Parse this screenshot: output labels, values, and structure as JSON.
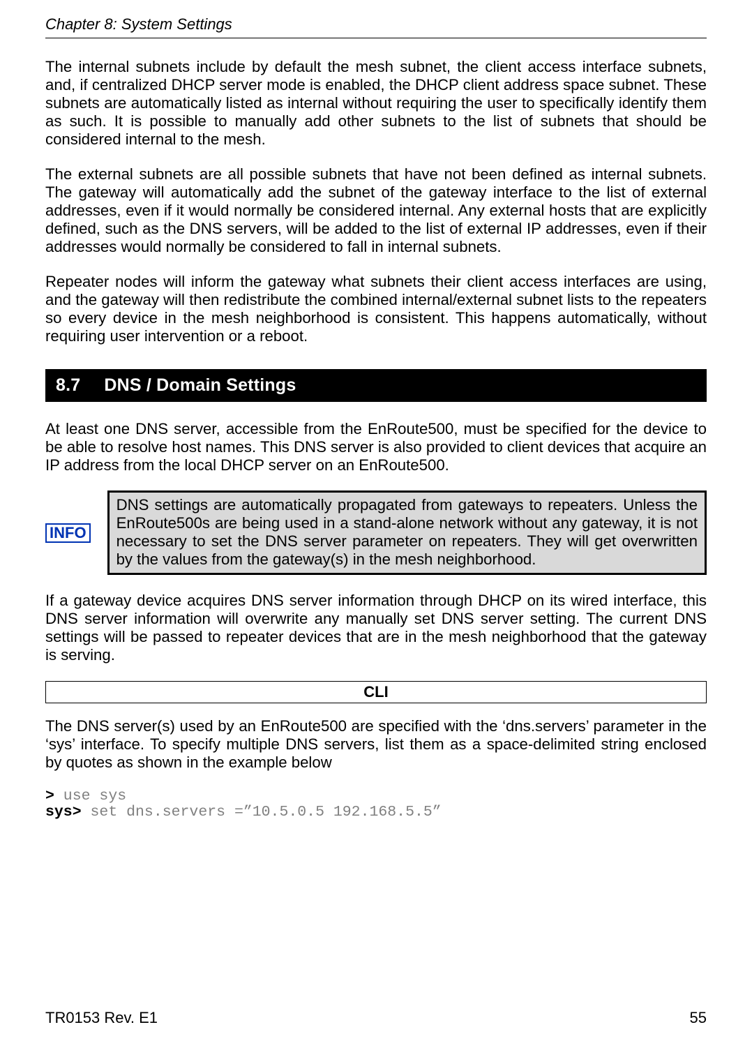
{
  "header": "Chapter 8: System Settings",
  "p1": "The internal subnets include by default the mesh subnet, the client access interface subnets, and, if centralized DHCP server mode is enabled, the DHCP client address space subnet. These subnets are automatically listed as internal without requiring the user to specifically identify them as such. It is possible to manually add other subnets to the list of subnets that should be considered internal to the mesh.",
  "p2": "The external subnets are all possible subnets that have not been defined as internal subnets. The gateway will automatically add the subnet of the gateway interface to the list of external addresses, even if it would normally be considered internal. Any external hosts that are explicitly defined, such as the DNS servers, will be added to the list of external IP addresses, even if their addresses would normally be considered to fall in internal subnets.",
  "p3": "Repeater nodes will inform the gateway what subnets their client access interfaces are using, and the gateway will then redistribute the combined internal/external subnet lists to the repeaters so every device in the mesh neighborhood is consistent. This happens automatically, without requiring user intervention or a reboot.",
  "section": {
    "num": "8.7",
    "title": "DNS / Domain Settings"
  },
  "p4": "At least one DNS server, accessible from the EnRoute500, must be specified for the device to be able to resolve host names. This DNS server is also provided to client devices that acquire an IP address from the local DHCP server on an EnRoute500.",
  "info_label": "INFO",
  "info_note": "DNS settings are automatically propagated from gateways to repeaters. Unless the EnRoute500s are being used in a stand-alone network without any gateway, it is not necessary to set the DNS server parameter on repeaters. They will get overwritten by the values from the gateway(s) in the mesh neighborhood.",
  "p5": "If a gateway device acquires DNS server information through DHCP on its wired interface, this DNS server information will overwrite any manually set DNS server setting. The current DNS settings will be passed to repeater devices that are in the mesh neighborhood that the gateway is serving.",
  "cli_label": "CLI",
  "p6": "The DNS server(s) used by an EnRoute500 are specified with the ‘dns.servers’ parameter in the ‘sys’ interface. To specify multiple DNS servers, list them as a space-delimited string enclosed by quotes as shown in the example below",
  "cli": {
    "prompt1": ">",
    "cmd1": " use sys",
    "prompt2": "sys>",
    "cmd2": " set dns.servers =”10.5.0.5 192.168.5.5”"
  },
  "footer": {
    "left": "TR0153 Rev. E1",
    "right": "55"
  }
}
